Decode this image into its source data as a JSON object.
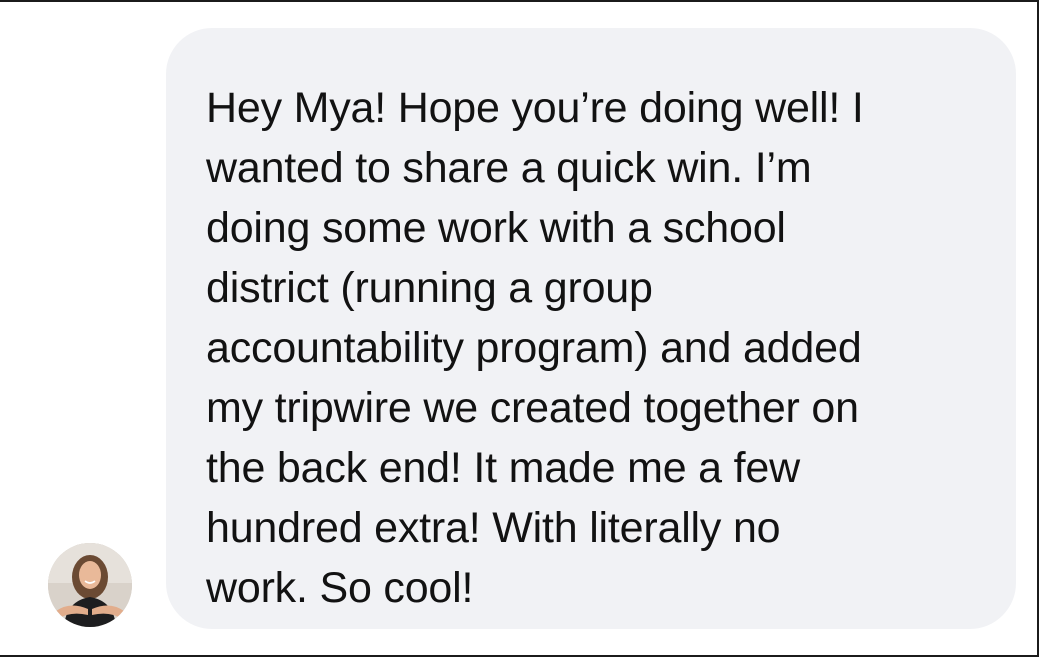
{
  "message": {
    "text": "Hey Mya! Hope you’re doing well! I\nwanted to share a quick win. I’m\ndoing some work with a school\ndistrict (running a group\naccountability program) and added\nmy tripwire we created together on\nthe back end! It made me a few\nhundred extra! With literally no\nwork. So cool!",
    "bubble_color": "#f1f2f5",
    "text_color": "#121212"
  },
  "sender": {
    "avatar_icon": "profile-photo"
  }
}
